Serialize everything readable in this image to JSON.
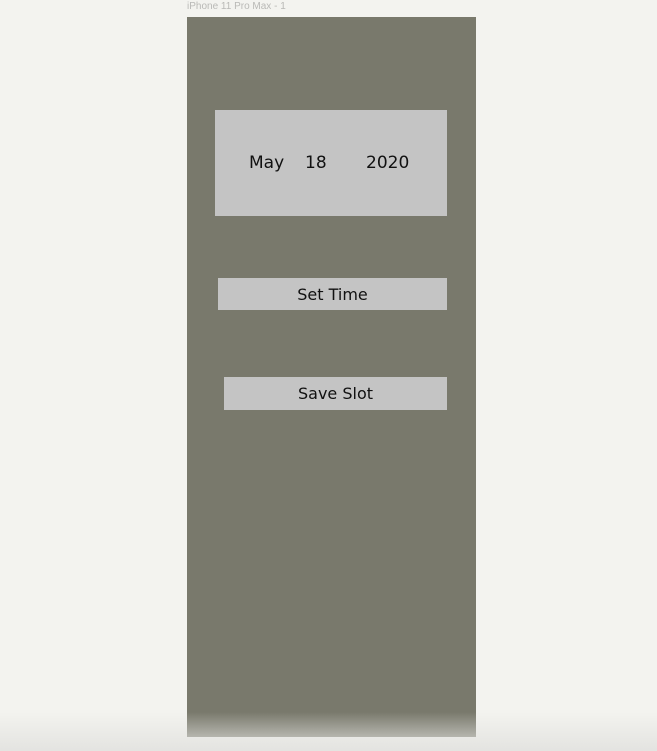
{
  "frame": {
    "label": "iPhone 11 Pro Max - 1"
  },
  "date_picker": {
    "month": "May",
    "day": "18",
    "year": "2020"
  },
  "buttons": {
    "set_time_label": "Set Time",
    "save_slot_label": "Save Slot"
  },
  "colors": {
    "canvas_background": "#f3f3ef",
    "artboard_background": "#79796c",
    "control_background": "#c4c4c4",
    "text": "#111111"
  }
}
